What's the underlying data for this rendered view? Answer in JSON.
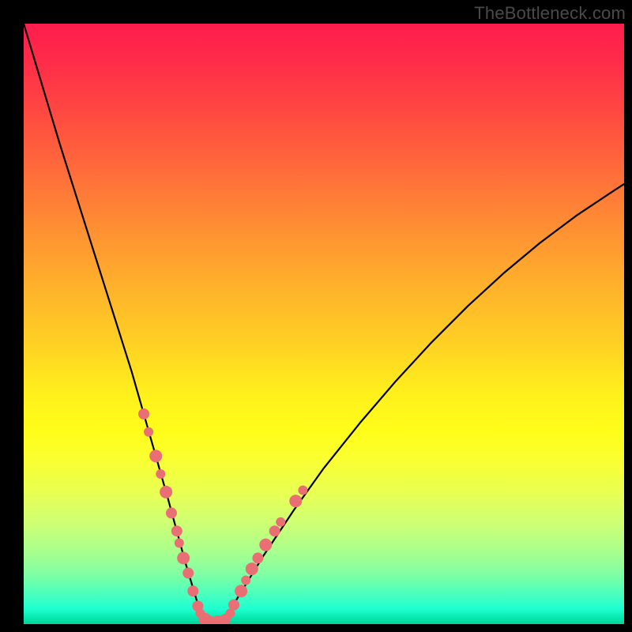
{
  "watermark": "TheBottleneck.com",
  "colors": {
    "frame": "#000000",
    "curve": "#000000",
    "dot_fill": "#e96f74",
    "dot_stroke": "#c84a52"
  },
  "chart_data": {
    "type": "line",
    "title": "",
    "xlabel": "",
    "ylabel": "",
    "xlim": [
      0,
      100
    ],
    "ylim": [
      0,
      100
    ],
    "series": [
      {
        "name": "bottleneck-curve",
        "x": [
          0,
          3,
          6,
          9,
          12,
          15,
          18,
          20,
          22,
          24,
          25.5,
          27,
          28.5,
          30,
          33,
          36,
          40,
          45,
          50,
          56,
          62,
          68,
          74,
          80,
          86,
          92,
          98,
          100
        ],
        "y": [
          100,
          90,
          80,
          70.5,
          61,
          51.5,
          42,
          35,
          28,
          21,
          15.5,
          10,
          5,
          0,
          0,
          5,
          11.5,
          19,
          26,
          33.5,
          40.5,
          47,
          53,
          58.5,
          63.5,
          68,
          72,
          73.3
        ]
      }
    ],
    "scatter": [
      {
        "name": "sample-points",
        "points": [
          {
            "x": 20.0,
            "y": 35.0,
            "r": 7
          },
          {
            "x": 20.8,
            "y": 32.0,
            "r": 6
          },
          {
            "x": 22.0,
            "y": 28.0,
            "r": 8
          },
          {
            "x": 22.8,
            "y": 25.0,
            "r": 6
          },
          {
            "x": 23.7,
            "y": 22.0,
            "r": 8
          },
          {
            "x": 24.6,
            "y": 18.5,
            "r": 7
          },
          {
            "x": 25.5,
            "y": 15.5,
            "r": 7
          },
          {
            "x": 25.9,
            "y": 13.5,
            "r": 6
          },
          {
            "x": 26.6,
            "y": 11.0,
            "r": 8
          },
          {
            "x": 27.4,
            "y": 8.5,
            "r": 7
          },
          {
            "x": 28.2,
            "y": 5.5,
            "r": 7
          },
          {
            "x": 29.0,
            "y": 3.0,
            "r": 7
          },
          {
            "x": 29.4,
            "y": 1.8,
            "r": 6
          },
          {
            "x": 30.2,
            "y": 0.8,
            "r": 8
          },
          {
            "x": 31.2,
            "y": 0.4,
            "r": 7
          },
          {
            "x": 32.4,
            "y": 0.4,
            "r": 8
          },
          {
            "x": 33.6,
            "y": 0.8,
            "r": 7
          },
          {
            "x": 34.4,
            "y": 1.8,
            "r": 6
          },
          {
            "x": 35.0,
            "y": 3.2,
            "r": 7
          },
          {
            "x": 36.2,
            "y": 5.5,
            "r": 8
          },
          {
            "x": 37.0,
            "y": 7.3,
            "r": 6
          },
          {
            "x": 38.0,
            "y": 9.2,
            "r": 8
          },
          {
            "x": 39.0,
            "y": 11.0,
            "r": 7
          },
          {
            "x": 40.3,
            "y": 13.2,
            "r": 8
          },
          {
            "x": 41.8,
            "y": 15.5,
            "r": 7
          },
          {
            "x": 42.8,
            "y": 17.0,
            "r": 6
          },
          {
            "x": 45.3,
            "y": 20.5,
            "r": 8
          },
          {
            "x": 46.5,
            "y": 22.3,
            "r": 6
          }
        ]
      }
    ]
  }
}
